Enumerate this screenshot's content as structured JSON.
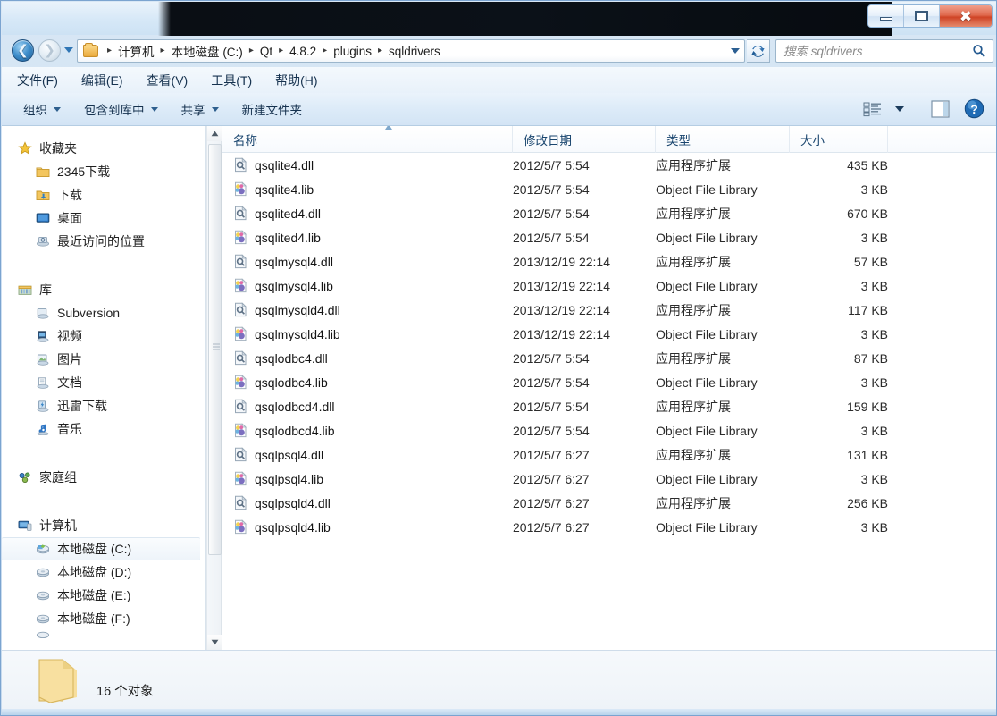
{
  "window": {
    "title": "",
    "controls": {
      "minimize_label": "–",
      "maximize_label": "❐",
      "close_label": "✕"
    }
  },
  "nav": {
    "back_label": "◀",
    "forward_label": "▶",
    "history_label": "▼",
    "refresh_label": "↻",
    "breadcrumb_root_icon": "folder-icon",
    "breadcrumbs": [
      "计算机",
      "本地磁盘 (C:)",
      "Qt",
      "4.8.2",
      "plugins",
      "sqldrivers"
    ],
    "separator": "▸"
  },
  "search": {
    "placeholder": "搜索 sqldrivers",
    "value": "",
    "icon": "search-icon"
  },
  "menubar": [
    {
      "label": "文件(F)",
      "text": "文件(F)"
    },
    {
      "label": "编辑(E)",
      "text": "编辑(E)"
    },
    {
      "label": "查看(V)",
      "text": "查看(V)"
    },
    {
      "label": "工具(T)",
      "text": "工具(T)"
    },
    {
      "label": "帮助(H)",
      "text": "帮助(H)"
    }
  ],
  "commandbar": {
    "items": [
      {
        "label": "组织",
        "has_caret": true
      },
      {
        "label": "包含到库中",
        "has_caret": true
      },
      {
        "label": "共享",
        "has_caret": true
      },
      {
        "label": "新建文件夹",
        "has_caret": false
      }
    ],
    "view_icon": "view-list-icon",
    "view_caret": "▼",
    "preview_icon": "preview-pane-icon",
    "help_icon": "help-icon",
    "help_label": "?"
  },
  "sidebar": {
    "groups": [
      {
        "header": {
          "label": "收藏夹",
          "icon": "star-icon"
        },
        "items": [
          {
            "label": "2345下载",
            "icon": "folder-icon"
          },
          {
            "label": "下载",
            "icon": "downloads-icon"
          },
          {
            "label": "桌面",
            "icon": "desktop-icon"
          },
          {
            "label": "最近访问的位置",
            "icon": "recent-places-icon"
          }
        ]
      },
      {
        "header": {
          "label": "库",
          "icon": "library-icon"
        },
        "items": [
          {
            "label": "Subversion",
            "icon": "library-folder-icon"
          },
          {
            "label": "视频",
            "icon": "videos-icon"
          },
          {
            "label": "图片",
            "icon": "pictures-icon"
          },
          {
            "label": "文档",
            "icon": "documents-icon"
          },
          {
            "label": "迅雷下载",
            "icon": "thunder-download-icon"
          },
          {
            "label": "音乐",
            "icon": "music-icon"
          }
        ]
      },
      {
        "header": {
          "label": "家庭组",
          "icon": "homegroup-icon"
        },
        "items": []
      },
      {
        "header": {
          "label": "计算机",
          "icon": "computer-icon"
        },
        "items": [
          {
            "label": "本地磁盘 (C:)",
            "icon": "system-drive-icon",
            "selected": true
          },
          {
            "label": "本地磁盘 (D:)",
            "icon": "drive-icon"
          },
          {
            "label": "本地磁盘 (E:)",
            "icon": "drive-icon"
          },
          {
            "label": "本地磁盘 (F:)",
            "icon": "drive-icon"
          }
        ]
      }
    ],
    "scrollbar": {
      "up_label": "▲",
      "down_label": "▼"
    }
  },
  "filelist": {
    "columns": [
      {
        "key": "name",
        "label": "名称",
        "sorted": "asc"
      },
      {
        "key": "date",
        "label": "修改日期"
      },
      {
        "key": "type",
        "label": "类型"
      },
      {
        "key": "size",
        "label": "大小"
      }
    ],
    "rows": [
      {
        "name": "qsqlite4.dll",
        "date": "2012/5/7 5:54",
        "type": "应用程序扩展",
        "size": "435 KB",
        "icon": "dll-icon"
      },
      {
        "name": "qsqlite4.lib",
        "date": "2012/5/7 5:54",
        "type": "Object File Library",
        "size": "3 KB",
        "icon": "lib-icon"
      },
      {
        "name": "qsqlited4.dll",
        "date": "2012/5/7 5:54",
        "type": "应用程序扩展",
        "size": "670 KB",
        "icon": "dll-icon"
      },
      {
        "name": "qsqlited4.lib",
        "date": "2012/5/7 5:54",
        "type": "Object File Library",
        "size": "3 KB",
        "icon": "lib-icon"
      },
      {
        "name": "qsqlmysql4.dll",
        "date": "2013/12/19 22:14",
        "type": "应用程序扩展",
        "size": "57 KB",
        "icon": "dll-icon"
      },
      {
        "name": "qsqlmysql4.lib",
        "date": "2013/12/19 22:14",
        "type": "Object File Library",
        "size": "3 KB",
        "icon": "lib-icon"
      },
      {
        "name": "qsqlmysqld4.dll",
        "date": "2013/12/19 22:14",
        "type": "应用程序扩展",
        "size": "117 KB",
        "icon": "dll-icon"
      },
      {
        "name": "qsqlmysqld4.lib",
        "date": "2013/12/19 22:14",
        "type": "Object File Library",
        "size": "3 KB",
        "icon": "lib-icon"
      },
      {
        "name": "qsqlodbc4.dll",
        "date": "2012/5/7 5:54",
        "type": "应用程序扩展",
        "size": "87 KB",
        "icon": "dll-icon"
      },
      {
        "name": "qsqlodbc4.lib",
        "date": "2012/5/7 5:54",
        "type": "Object File Library",
        "size": "3 KB",
        "icon": "lib-icon"
      },
      {
        "name": "qsqlodbcd4.dll",
        "date": "2012/5/7 5:54",
        "type": "应用程序扩展",
        "size": "159 KB",
        "icon": "dll-icon"
      },
      {
        "name": "qsqlodbcd4.lib",
        "date": "2012/5/7 5:54",
        "type": "Object File Library",
        "size": "3 KB",
        "icon": "lib-icon"
      },
      {
        "name": "qsqlpsql4.dll",
        "date": "2012/5/7 6:27",
        "type": "应用程序扩展",
        "size": "131 KB",
        "icon": "dll-icon"
      },
      {
        "name": "qsqlpsql4.lib",
        "date": "2012/5/7 6:27",
        "type": "Object File Library",
        "size": "3 KB",
        "icon": "lib-icon"
      },
      {
        "name": "qsqlpsqld4.dll",
        "date": "2012/5/7 6:27",
        "type": "应用程序扩展",
        "size": "256 KB",
        "icon": "dll-icon"
      },
      {
        "name": "qsqlpsqld4.lib",
        "date": "2012/5/7 6:27",
        "type": "Object File Library",
        "size": "3 KB",
        "icon": "lib-icon"
      }
    ]
  },
  "statusbar": {
    "folder_icon": "large-folder-icon",
    "text": "16 个对象"
  },
  "colors": {
    "title_band": "#0a0e14",
    "frame": "#7ba4d0",
    "close_button": "#cf4426",
    "accent_blue": "#2f76b5",
    "header_text": "#19456e",
    "folder_yellow": "#e9a93c"
  }
}
